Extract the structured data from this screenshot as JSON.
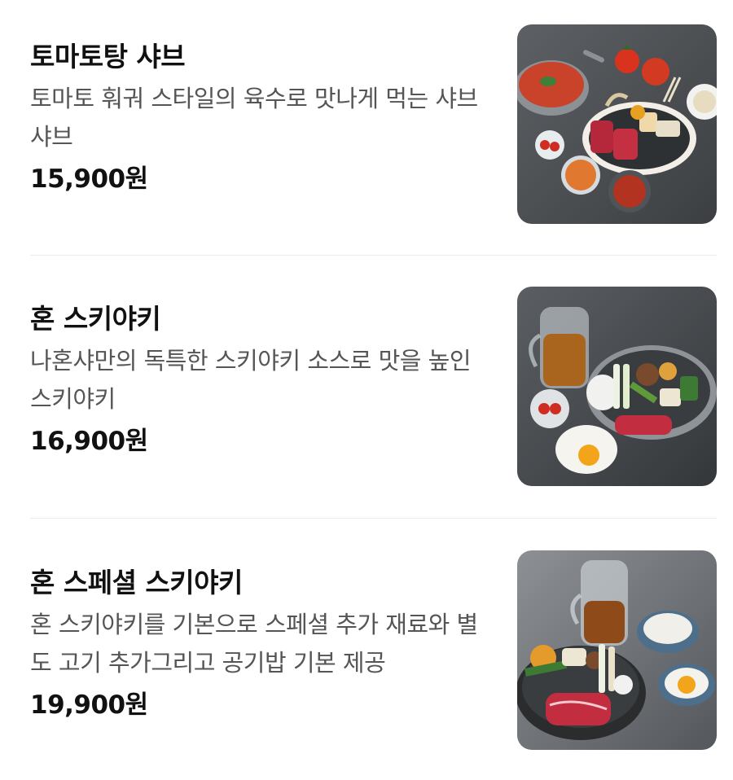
{
  "menu": {
    "items": [
      {
        "name": "토마토탕 샤브",
        "description": "토마토 훠궈 스타일의 육수로 맛나게 먹는 샤브샤브",
        "price": "15,900원",
        "photo_icon": "tomato-shabu-photo"
      },
      {
        "name": "혼 스키야키",
        "description": "나혼샤만의 독특한 스키야키 소스로 맛을 높인 스키야키",
        "price": "16,900원",
        "photo_icon": "sukiyaki-photo"
      },
      {
        "name": "혼 스페셜 스키야키",
        "description": "혼 스키야키를 기본으로 스페셜 추가 재료와 별도 고기 추가그리고 공기밥 기본 제공",
        "price": "19,900원",
        "photo_icon": "special-sukiyaki-photo"
      }
    ]
  },
  "colors": {
    "title": "#111111",
    "description": "#555555",
    "divider": "#ececec",
    "photo_background": "#4a4d50"
  }
}
